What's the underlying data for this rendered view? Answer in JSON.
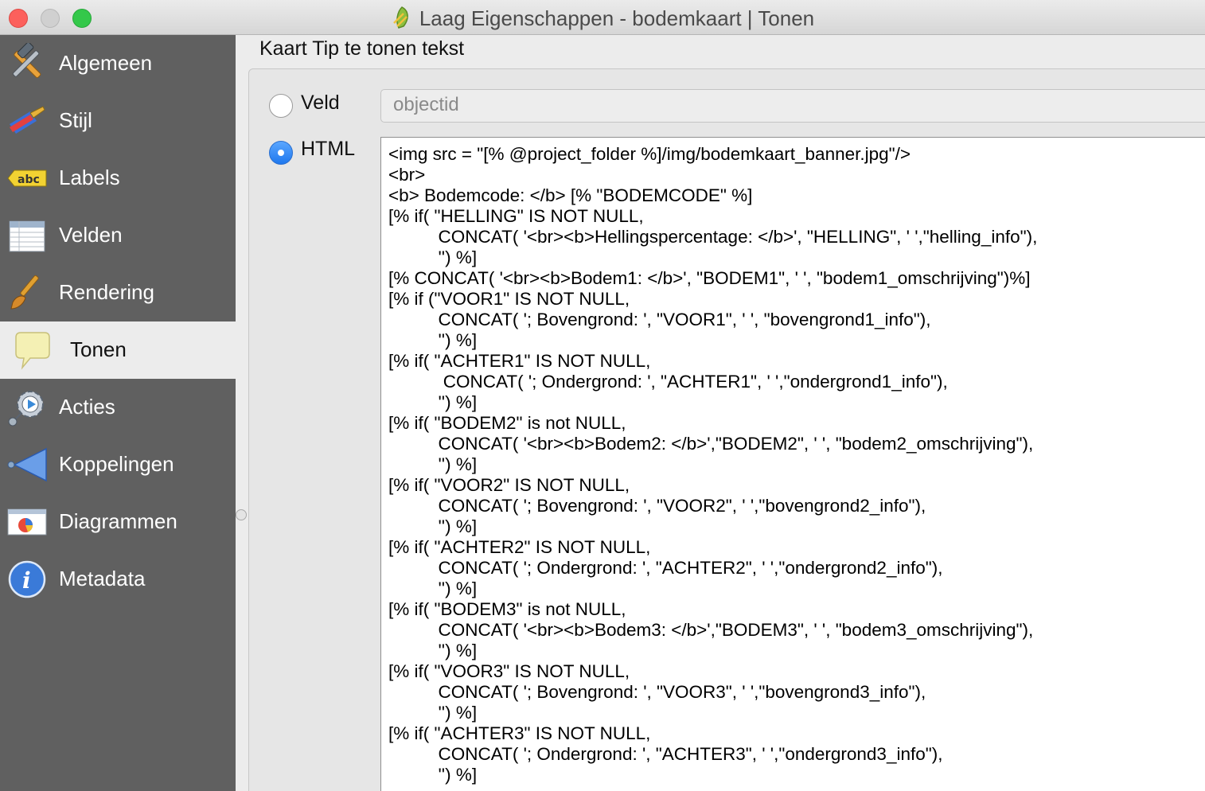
{
  "window": {
    "title": "Laag Eigenschappen - bodemkaart | Tonen"
  },
  "sidebar": {
    "items": [
      {
        "label": "Algemeen",
        "icon": "hammer-wrench-icon"
      },
      {
        "label": "Stijl",
        "icon": "paintbrush-icon"
      },
      {
        "label": "Labels",
        "icon": "abc-label-icon"
      },
      {
        "label": "Velden",
        "icon": "table-icon"
      },
      {
        "label": "Rendering",
        "icon": "brush-icon"
      },
      {
        "label": "Tonen",
        "icon": "speech-bubble-icon",
        "active": true
      },
      {
        "label": "Acties",
        "icon": "gear-icon"
      },
      {
        "label": "Koppelingen",
        "icon": "join-arrow-icon"
      },
      {
        "label": "Diagrammen",
        "icon": "pie-chart-icon"
      },
      {
        "label": "Metadata",
        "icon": "info-icon"
      }
    ]
  },
  "main": {
    "section_title": "Kaart Tip te tonen tekst",
    "radio_field_label": "Veld",
    "radio_html_label": "HTML",
    "selected_option": "HTML",
    "field_value": "objectid",
    "html_lines": [
      "<img src = \"[% @project_folder %]/img/bodemkaart_banner.jpg\"/>",
      "<br>",
      "<b> Bodemcode: </b> [% \"BODEMCODE\" %]",
      "[% if( \"HELLING\" IS NOT NULL,",
      "          CONCAT( '<br><b>Hellingspercentage: </b>', \"HELLING\", ' ',\"helling_info\"),",
      "          '') %]",
      "[% CONCAT( '<br><b>Bodem1: </b>', \"BODEM1\", ' ', \"bodem1_omschrijving\")%]",
      "[% if (\"VOOR1\" IS NOT NULL,",
      "          CONCAT( '; Bovengrond: ', \"VOOR1\", ' ', \"bovengrond1_info\"),",
      "          '') %]",
      "[% if( \"ACHTER1\" IS NOT NULL,",
      "           CONCAT( '; Ondergrond: ', \"ACHTER1\", ' ',\"ondergrond1_info\"),",
      "          '') %]",
      "[% if( \"BODEM2\" is not NULL,",
      "          CONCAT( '<br><b>Bodem2: </b>',\"BODEM2\", ' ', \"bodem2_omschrijving\"),",
      "          '') %]",
      "[% if( \"VOOR2\" IS NOT NULL,",
      "          CONCAT( '; Bovengrond: ', \"VOOR2\", ' ',\"bovengrond2_info\"),",
      "          '') %]",
      "[% if( \"ACHTER2\" IS NOT NULL,",
      "          CONCAT( '; Ondergrond: ', \"ACHTER2\", ' ',\"ondergrond2_info\"),",
      "          '') %]",
      "[% if( \"BODEM3\" is not NULL,",
      "          CONCAT( '<br><b>Bodem3: </b>',\"BODEM3\", ' ', \"bodem3_omschrijving\"),",
      "          '') %]",
      "[% if( \"VOOR3\" IS NOT NULL,",
      "          CONCAT( '; Bovengrond: ', \"VOOR3\", ' ',\"bovengrond3_info\"),",
      "          '') %]",
      "[% if( \"ACHTER3\" IS NOT NULL,",
      "          CONCAT( '; Ondergrond: ', \"ACHTER3\", ' ',\"ondergrond3_info\"),",
      "          '') %]"
    ]
  },
  "colors": {
    "sidebar_bg": "#606060",
    "selected_item_bg": "#ececec",
    "radio_accent": "#1f78ee"
  }
}
